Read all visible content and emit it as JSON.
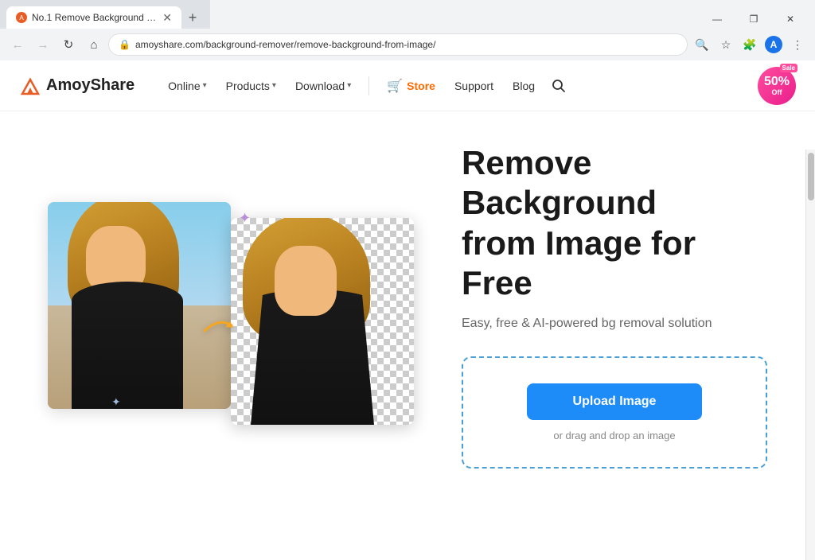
{
  "browser": {
    "tab": {
      "title": "No.1 Remove Background from...",
      "favicon_initial": "A"
    },
    "address": "amoyshare.com/background-remover/remove-background-from-image/",
    "new_tab_label": "+",
    "window_controls": [
      "—",
      "❐",
      "✕"
    ]
  },
  "navbar": {
    "logo_text": "AmoyShare",
    "nav_items": [
      {
        "label": "Online",
        "has_dropdown": true
      },
      {
        "label": "Products",
        "has_dropdown": true
      },
      {
        "label": "Download",
        "has_dropdown": true
      }
    ],
    "store_label": "Store",
    "support_label": "Support",
    "blog_label": "Blog",
    "sale_badge": {
      "sale": "Sale",
      "percent": "50%",
      "off": "Off"
    }
  },
  "hero": {
    "title": "Remove Background\nfrom Image for Free",
    "subtitle": "Easy, free & AI-powered bg removal solution",
    "upload_button_label": "Upload Image",
    "upload_hint": "or drag and drop an image",
    "arrow": "➜"
  }
}
